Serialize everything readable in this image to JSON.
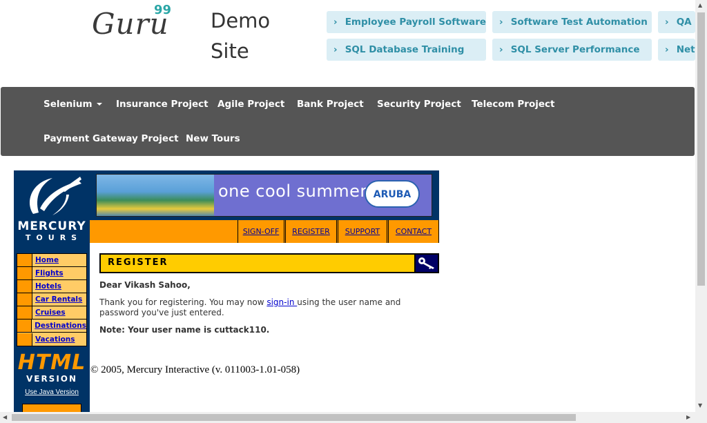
{
  "header": {
    "logo_word": "Guru",
    "logo_number": "99",
    "site_title": "Demo Site",
    "top_links": [
      "Employee Payroll Software",
      "Software Test Automation",
      "QA S",
      "SQL Database Training",
      "SQL Server Performance",
      "Netv"
    ]
  },
  "navbar": {
    "items": [
      "Selenium",
      "Insurance Project",
      "Agile Project",
      "Bank Project",
      "Security Project",
      "Telecom Project",
      "Payment Gateway Project",
      "New Tours"
    ]
  },
  "mercury": {
    "brand_line1": "MERCURY",
    "brand_line2": "TOURS",
    "banner_text": "one cool summer",
    "banner_logo": "ARUBA",
    "top_nav": [
      "SIGN-OFF",
      "REGISTER",
      "SUPPORT",
      "CONTACT"
    ],
    "side_menu": [
      "Home",
      "Flights",
      "Hotels",
      "Car Rentals",
      "Cruises",
      "Destinations",
      "Vacations"
    ],
    "html_version_line1": "HTML",
    "html_version_line2": "VERSION",
    "java_link": "Use Java Version",
    "section_title": "REGISTER",
    "greeting": "Dear Vikash Sahoo,",
    "thanks_before": "Thank you for registering. You may now ",
    "thanks_link": "sign-in ",
    "thanks_after": "using the user name and password you've just entered.",
    "note": "Note: Your user name is cuttack110.",
    "copyright": "© 2005, Mercury Interactive (v. 011003-1.01-058)"
  },
  "colors": {
    "nav_bg": "#555555",
    "top_link_bg": "#dbeef5",
    "top_link_text": "#2f8fa6",
    "mercury_navy": "#003366",
    "mercury_orange": "#ff9900",
    "register_yellow": "#ffcc00"
  }
}
